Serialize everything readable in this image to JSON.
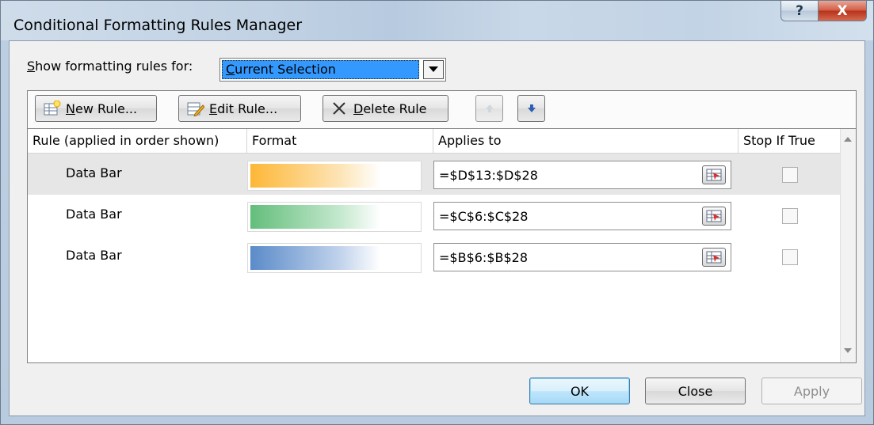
{
  "window": {
    "title": "Conditional Formatting Rules Manager",
    "help_glyph": "?",
    "close_glyph": "X"
  },
  "show_rules": {
    "label_prefix": "",
    "label_mnemonic": "S",
    "label_rest": "how formatting rules for:",
    "selected_mnemonic": "C",
    "selected_rest": "urrent Selection"
  },
  "toolbar": {
    "new_rule_mnemonic": "N",
    "new_rule_rest": "ew Rule...",
    "edit_rule_mnemonic": "E",
    "edit_rule_rest": "dit Rule...",
    "delete_rule_mnemonic": "D",
    "delete_rule_rest": "elete Rule"
  },
  "table": {
    "columns": [
      "Rule (applied in order shown)",
      "Format",
      "Applies to",
      "Stop If True"
    ],
    "rows": [
      {
        "rule": "Data Bar",
        "applies_to": "=$D$13:$D$28",
        "bar_color": "#fdb737",
        "stop_if_true": false,
        "selected": true
      },
      {
        "rule": "Data Bar",
        "applies_to": "=$C$6:$C$28",
        "bar_color": "#63be7b",
        "stop_if_true": false,
        "selected": false
      },
      {
        "rule": "Data Bar",
        "applies_to": "=$B$6:$B$28",
        "bar_color": "#5b8bc9",
        "stop_if_true": false,
        "selected": false
      }
    ]
  },
  "buttons": {
    "ok": "OK",
    "close": "Close",
    "apply": "Apply"
  }
}
